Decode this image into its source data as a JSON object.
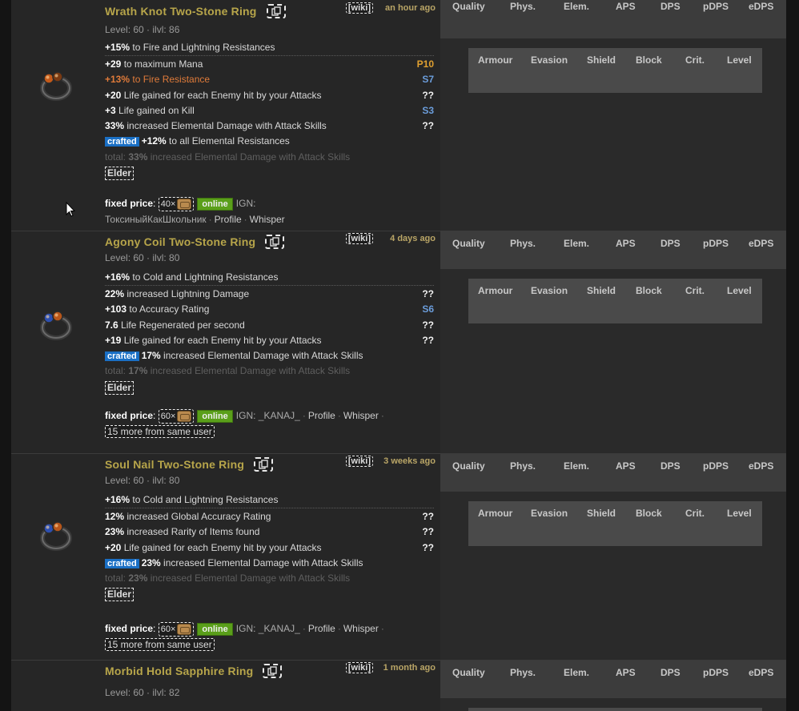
{
  "stat_headers": [
    "Quality",
    "Phys.",
    "Elem.",
    "APS",
    "DPS",
    "pDPS",
    "eDPS"
  ],
  "defense_headers": [
    "Armour",
    "Evasion",
    "Shield",
    "Block",
    "Crit.",
    "Level"
  ],
  "labels": {
    "wiki": "[wiki]",
    "price_label": "fixed price",
    "online": "online",
    "ign_prefix": "IGN:",
    "profile": "Profile",
    "whisper": "Whisper",
    "elder": "Elder",
    "crafted": "crafted"
  },
  "items": [
    {
      "name": "Wrath Knot Two-Stone Ring",
      "age": "an hour ago",
      "level_line": "Level: 60 · ilvl: 86",
      "implicit": {
        "num": "+15%",
        "text": " to Fire and Lightning Resistances"
      },
      "mods": [
        {
          "num": "+29",
          "text": " to maximum Mana",
          "tier": "P10"
        },
        {
          "num": "+13%",
          "text": " to Fire Resistance",
          "tier": "S7"
        },
        {
          "num": "+20",
          "text": " Life gained for each Enemy hit by your Attacks",
          "tier": "??"
        },
        {
          "num": "+3",
          "text": " Life gained on Kill",
          "tier": "S3"
        },
        {
          "num": "33%",
          "text": " increased Elemental Damage with Attack Skills",
          "tier": "??"
        }
      ],
      "crafted": {
        "num": "+12%",
        "text": " to all Elemental Resistances"
      },
      "total": {
        "prefix": "total: ",
        "num": "33%",
        "text": " increased Elemental Damage with Attack Skills"
      },
      "price_amount": "40",
      "ign": "ТоксиныйКакШкольник",
      "more": ""
    },
    {
      "name": "Agony Coil Two-Stone Ring",
      "age": "4 days ago",
      "level_line": "Level: 60 · ilvl: 80",
      "implicit": {
        "num": "+16%",
        "text": " to Cold and Lightning Resistances"
      },
      "mods": [
        {
          "num": "22%",
          "text": " increased Lightning Damage",
          "tier": "??"
        },
        {
          "num": "+103",
          "text": " to Accuracy Rating",
          "tier": "S6"
        },
        {
          "num": "7.6",
          "text": " Life Regenerated per second",
          "tier": "??"
        },
        {
          "num": "+19",
          "text": " Life gained for each Enemy hit by your Attacks",
          "tier": "??"
        }
      ],
      "crafted": {
        "num": "17%",
        "text": " increased Elemental Damage with Attack Skills"
      },
      "total": {
        "prefix": "total: ",
        "num": "17%",
        "text": " increased Elemental Damage with Attack Skills"
      },
      "price_amount": "60",
      "ign": "_KANAJ_",
      "more": "15 more from same user"
    },
    {
      "name": "Soul Nail Two-Stone Ring",
      "age": "3 weeks ago",
      "level_line": "Level: 60 · ilvl: 80",
      "implicit": {
        "num": "+16%",
        "text": " to Cold and Lightning Resistances"
      },
      "mods": [
        {
          "num": "12%",
          "text": " increased Global Accuracy Rating",
          "tier": "??"
        },
        {
          "num": "23%",
          "text": " increased Rarity of Items found",
          "tier": "??"
        },
        {
          "num": "+20",
          "text": " Life gained for each Enemy hit by your Attacks",
          "tier": "??"
        }
      ],
      "crafted": {
        "num": "23%",
        "text": " increased Elemental Damage with Attack Skills"
      },
      "total": {
        "prefix": "total: ",
        "num": "23%",
        "text": " increased Elemental Damage with Attack Skills"
      },
      "price_amount": "60",
      "ign": "_KANAJ_",
      "more": "15 more from same user"
    },
    {
      "name": "Morbid Hold Sapphire Ring",
      "age": "1 month ago",
      "level_line": "Level: 60 · ilvl: 82"
    }
  ]
}
